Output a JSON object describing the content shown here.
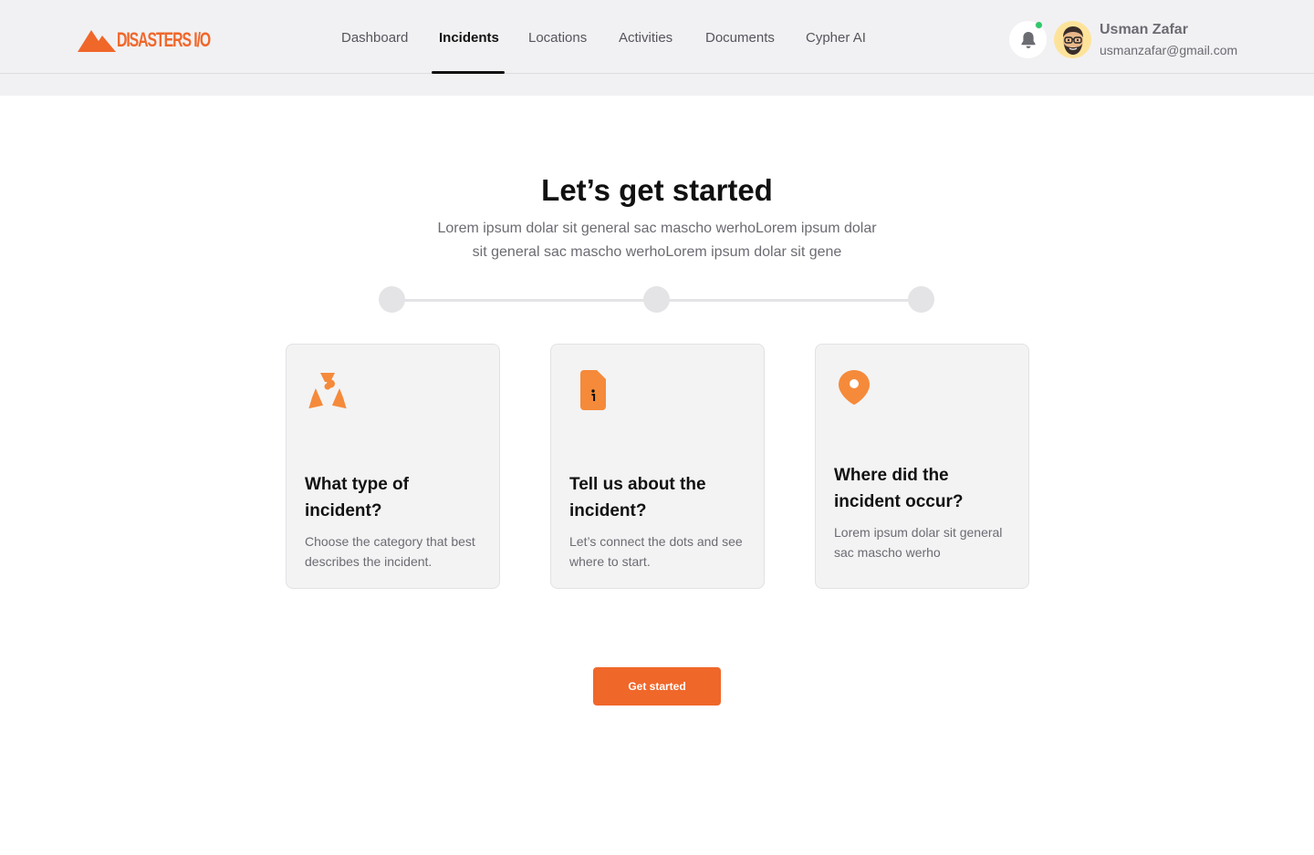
{
  "brand": {
    "logo_text": "DISASTERS I/O",
    "color": "#f0672a"
  },
  "nav": {
    "items": [
      {
        "label": "Dashboard",
        "active": false
      },
      {
        "label": "Incidents",
        "active": true
      },
      {
        "label": "Locations",
        "active": false
      },
      {
        "label": "Activities",
        "active": false
      },
      {
        "label": "Documents",
        "active": false
      },
      {
        "label": "Cypher AI",
        "active": false
      }
    ]
  },
  "user": {
    "name": "Usman Zafar",
    "email": "usmanzafar@gmail.com",
    "has_notification": true,
    "notification_color": "#2fc86a"
  },
  "hero": {
    "title": "Let’s get started",
    "subtitle": "Lorem ipsum dolar sit general sac mascho werhoLorem ipsum dolar sit general sac mascho werhoLorem ipsum dolar sit gene"
  },
  "stepper": {
    "steps": 3,
    "current_step": 0
  },
  "cards": [
    {
      "icon": "radiation-icon",
      "title": "What type of incident?",
      "description": "Choose the category that best describes the incident."
    },
    {
      "icon": "info-document-icon",
      "title": "Tell us about the incident?",
      "description": "Let’s connect the dots and see where to start."
    },
    {
      "icon": "location-pin-icon",
      "title": "Where did the incident occur?",
      "description": "Lorem ipsum dolar sit general sac mascho werho"
    }
  ],
  "cta": {
    "label": "Get started"
  },
  "colors": {
    "accent": "#f0672a",
    "icon_orange": "#f58a3a",
    "card_bg": "#f3f3f4",
    "topbar_bg": "#f1f1f3"
  }
}
